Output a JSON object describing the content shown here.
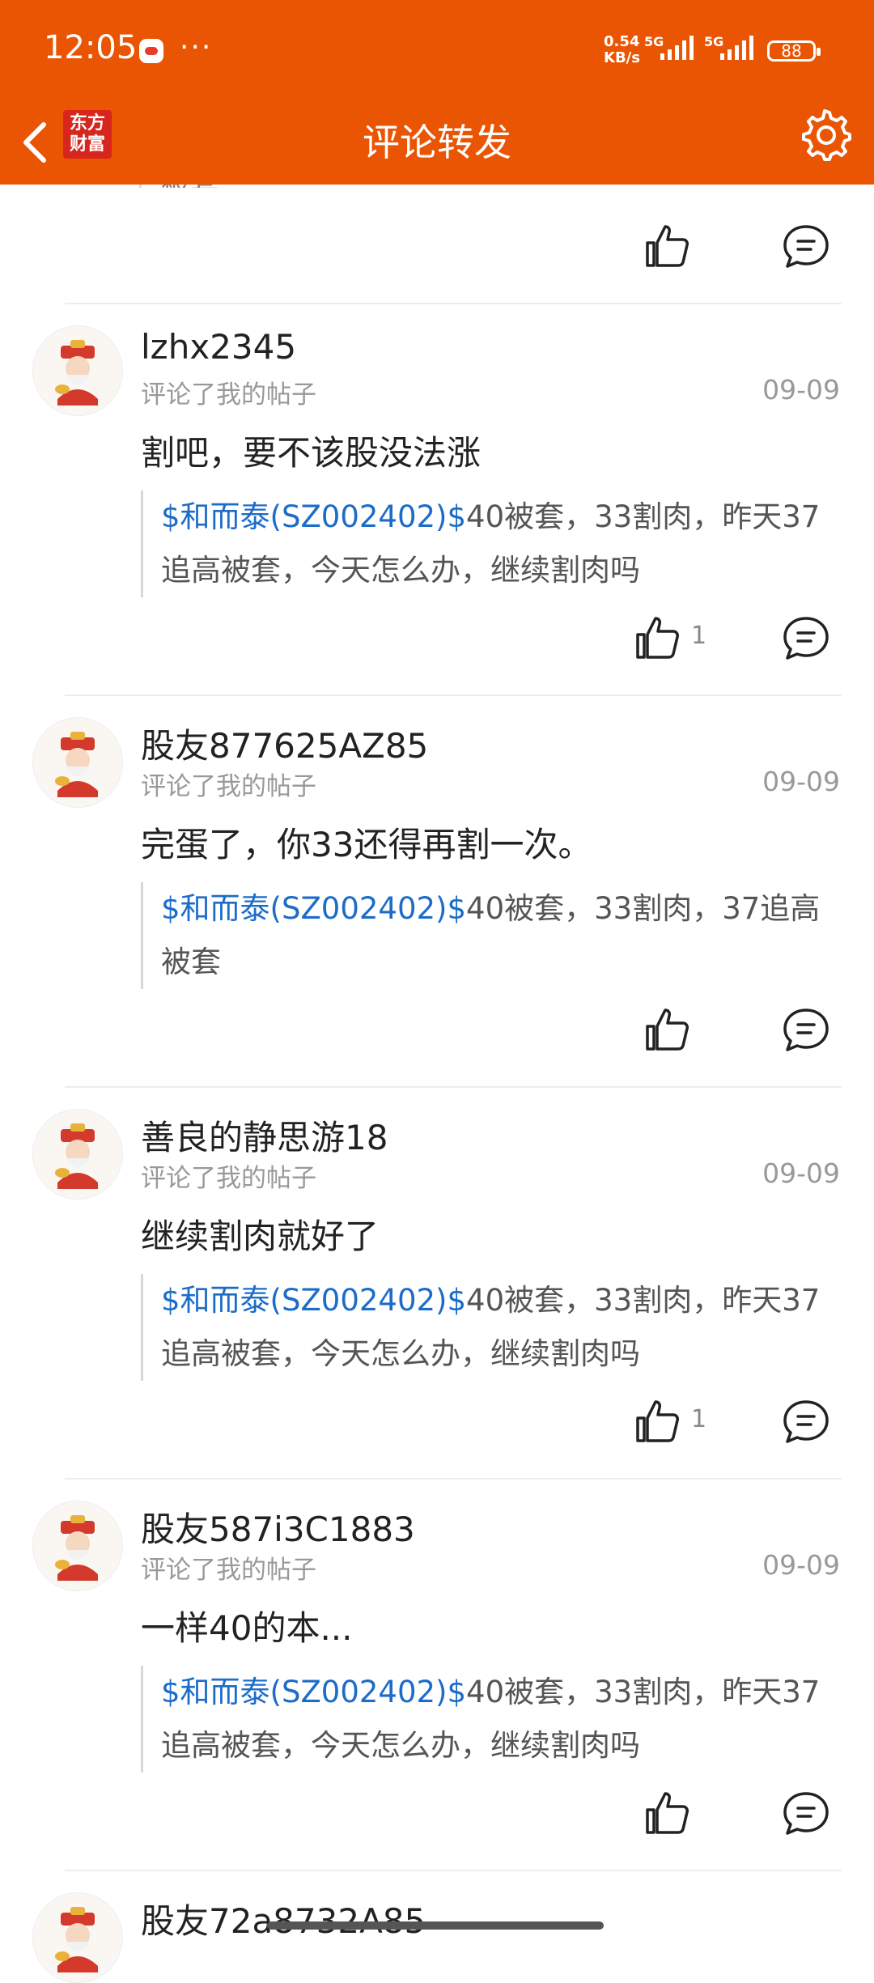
{
  "status_bar": {
    "time": "12:05",
    "more": "···",
    "net_speed_value": "0.54",
    "net_speed_unit": "KB/s",
    "sim1": "5G",
    "sim2": "5G",
    "battery": "88"
  },
  "nav": {
    "title": "评论转发",
    "logo_text_top": "东方",
    "logo_text_bottom": "财富"
  },
  "partial_top": {
    "quote_tail": "被套"
  },
  "comments": [
    {
      "username": "lzhx2345",
      "action": "评论了我的帖子",
      "date": "09-09",
      "text": "割吧，要不该股没法涨",
      "quote_stock": "$和而泰(SZ002402)$",
      "quote_text_line1": "40被套，33割肉，昨天37",
      "quote_text_line2": "追高被套，今天怎么办，继续割肉吗",
      "likes": "1"
    },
    {
      "username": "股友877625AZ85",
      "action": "评论了我的帖子",
      "date": "09-09",
      "text": "完蛋了，你33还得再割一次。",
      "quote_stock": "$和而泰(SZ002402)$",
      "quote_text_line1": "40被套，33割肉，37追高",
      "quote_text_line2": "被套",
      "likes": ""
    },
    {
      "username": "善良的静思游18",
      "action": "评论了我的帖子",
      "date": "09-09",
      "text": "继续割肉就好了",
      "quote_stock": "$和而泰(SZ002402)$",
      "quote_text_line1": "40被套，33割肉，昨天37",
      "quote_text_line2": "追高被套，今天怎么办，继续割肉吗",
      "likes": "1"
    },
    {
      "username": "股友587i3C1883",
      "action": "评论了我的帖子",
      "date": "09-09",
      "text": "一样40的本...",
      "quote_stock": "$和而泰(SZ002402)$",
      "quote_text_line1": "40被套，33割肉，昨天37",
      "quote_text_line2": "追高被套，今天怎么办，继续割肉吗",
      "likes": ""
    },
    {
      "username": "股友72a8732A85"
    }
  ]
}
